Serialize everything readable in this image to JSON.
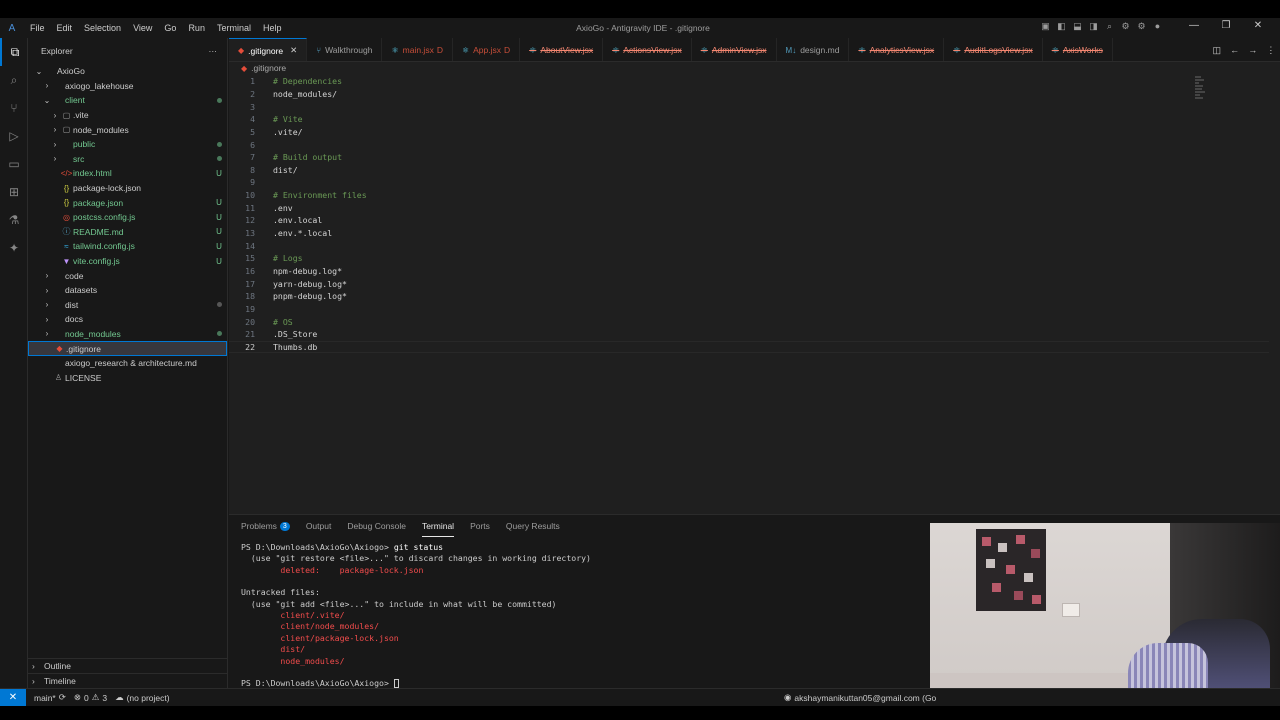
{
  "window": {
    "title": "AxioGo - Antigravity IDE - .gitignore",
    "menu": [
      "File",
      "Edit",
      "Selection",
      "View",
      "Go",
      "Run",
      "Terminal",
      "Help"
    ],
    "controls": [
      "—",
      "❐",
      "✕"
    ]
  },
  "activity_bar": [
    "explorer-icon",
    "search-icon",
    "source-control-icon",
    "run-debug-icon",
    "remote-icon",
    "extensions-icon",
    "testing-icon",
    "agent-icon"
  ],
  "sidebar": {
    "title": "Explorer",
    "more": "···",
    "tree": [
      {
        "label": "AxioGo",
        "depth": 0,
        "chevron": "⌄",
        "icon": "",
        "status": "",
        "color": "plain"
      },
      {
        "label": "axiogo_lakehouse",
        "depth": 1,
        "chevron": "›",
        "icon": "",
        "status": "",
        "color": "plain"
      },
      {
        "label": "client",
        "depth": 1,
        "chevron": "⌄",
        "icon": "",
        "status": "dot",
        "color": "add"
      },
      {
        "label": ".vite",
        "depth": 2,
        "chevron": "›",
        "icon": "▢",
        "status": "",
        "color": "plain"
      },
      {
        "label": "node_modules",
        "depth": 2,
        "chevron": "›",
        "icon": "▢",
        "status": "",
        "color": "plain"
      },
      {
        "label": "public",
        "depth": 2,
        "chevron": "›",
        "icon": "",
        "status": "dot",
        "color": "add"
      },
      {
        "label": "src",
        "depth": 2,
        "chevron": "›",
        "icon": "",
        "status": "dot",
        "color": "add"
      },
      {
        "label": "index.html",
        "depth": 2,
        "chevron": "",
        "icon": "</>",
        "status": "U",
        "color": "add"
      },
      {
        "label": "package-lock.json",
        "depth": 2,
        "chevron": "",
        "icon": "{}",
        "status": "",
        "color": "plain"
      },
      {
        "label": "package.json",
        "depth": 2,
        "chevron": "",
        "icon": "{}",
        "status": "U",
        "color": "add"
      },
      {
        "label": "postcss.config.js",
        "depth": 2,
        "chevron": "",
        "icon": "◎",
        "status": "U",
        "color": "add"
      },
      {
        "label": "README.md",
        "depth": 2,
        "chevron": "",
        "icon": "ⓘ",
        "status": "U",
        "color": "add"
      },
      {
        "label": "tailwind.config.js",
        "depth": 2,
        "chevron": "",
        "icon": "≈",
        "status": "U",
        "color": "add"
      },
      {
        "label": "vite.config.js",
        "depth": 2,
        "chevron": "",
        "icon": "▼",
        "status": "U",
        "color": "add"
      },
      {
        "label": "code",
        "depth": 1,
        "chevron": "›",
        "icon": "",
        "status": "",
        "color": "plain"
      },
      {
        "label": "datasets",
        "depth": 1,
        "chevron": "›",
        "icon": "",
        "status": "",
        "color": "plain"
      },
      {
        "label": "dist",
        "depth": 1,
        "chevron": "›",
        "icon": "",
        "status": "graydot",
        "color": "plain"
      },
      {
        "label": "docs",
        "depth": 1,
        "chevron": "›",
        "icon": "",
        "status": "",
        "color": "plain"
      },
      {
        "label": "node_modules",
        "depth": 1,
        "chevron": "›",
        "icon": "",
        "status": "dot",
        "color": "add"
      },
      {
        "label": ".gitignore",
        "depth": 1,
        "chevron": "",
        "icon": "◆",
        "status": "",
        "color": "plain",
        "selected": true
      },
      {
        "label": "axiogo_research & architecture.md",
        "depth": 1,
        "chevron": "",
        "icon": "",
        "status": "",
        "color": "plain"
      },
      {
        "label": "LICENSE",
        "depth": 1,
        "chevron": "",
        "icon": "♙",
        "status": "",
        "color": "plain"
      }
    ],
    "outline": "Outline",
    "timeline": "Timeline"
  },
  "tabs": [
    {
      "label": ".gitignore",
      "icon": "◆",
      "kind": "active",
      "suffix": "",
      "close": "✕"
    },
    {
      "label": "Walkthrough",
      "icon": "⑂",
      "kind": "plain",
      "suffix": ""
    },
    {
      "label": "main.jsx",
      "icon": "⚛",
      "kind": "del",
      "suffix": "D"
    },
    {
      "label": "App.jsx",
      "icon": "⚛",
      "kind": "del",
      "suffix": "D"
    },
    {
      "label": "AboutView.jsx",
      "icon": "⚛",
      "kind": "err",
      "suffix": ""
    },
    {
      "label": "ActionsView.jsx",
      "icon": "⚛",
      "kind": "err",
      "suffix": ""
    },
    {
      "label": "AdminView.jsx",
      "icon": "⚛",
      "kind": "err",
      "suffix": ""
    },
    {
      "label": "design.md",
      "icon": "M↓",
      "kind": "plain",
      "suffix": ""
    },
    {
      "label": "AnalyticsView.jsx",
      "icon": "⚛",
      "kind": "err",
      "suffix": ""
    },
    {
      "label": "AuditLogsView.jsx",
      "icon": "⚛",
      "kind": "err",
      "suffix": ""
    },
    {
      "label": "AxisWorks",
      "icon": "⚛",
      "kind": "err",
      "suffix": ""
    }
  ],
  "breadcrumb": ".gitignore",
  "editor": {
    "current_line": 22,
    "lines": [
      {
        "n": "1",
        "text": "# Dependencies",
        "comment": true
      },
      {
        "n": "2",
        "text": "node_modules/",
        "comment": false
      },
      {
        "n": "3",
        "text": "",
        "comment": false
      },
      {
        "n": "4",
        "text": "# Vite",
        "comment": true
      },
      {
        "n": "5",
        "text": ".vite/",
        "comment": false
      },
      {
        "n": "6",
        "text": "",
        "comment": false
      },
      {
        "n": "7",
        "text": "# Build output",
        "comment": true
      },
      {
        "n": "8",
        "text": "dist/",
        "comment": false
      },
      {
        "n": "9",
        "text": "",
        "comment": false
      },
      {
        "n": "10",
        "text": "# Environment files",
        "comment": true
      },
      {
        "n": "11",
        "text": ".env",
        "comment": false
      },
      {
        "n": "12",
        "text": ".env.local",
        "comment": false
      },
      {
        "n": "13",
        "text": ".env.*.local",
        "comment": false
      },
      {
        "n": "14",
        "text": "",
        "comment": false
      },
      {
        "n": "15",
        "text": "# Logs",
        "comment": true
      },
      {
        "n": "16",
        "text": "npm-debug.log*",
        "comment": false
      },
      {
        "n": "17",
        "text": "yarn-debug.log*",
        "comment": false
      },
      {
        "n": "18",
        "text": "pnpm-debug.log*",
        "comment": false
      },
      {
        "n": "19",
        "text": "",
        "comment": false
      },
      {
        "n": "20",
        "text": "# OS",
        "comment": true
      },
      {
        "n": "21",
        "text": ".DS_Store",
        "comment": false
      },
      {
        "n": "22",
        "text": "Thumbs.db",
        "comment": false
      }
    ]
  },
  "panel": {
    "tabs": [
      {
        "label": "Problems",
        "count": "3"
      },
      {
        "label": "Output"
      },
      {
        "label": "Debug Console"
      },
      {
        "label": "Terminal",
        "active": true
      },
      {
        "label": "Ports"
      },
      {
        "label": "Query Results"
      }
    ],
    "terminal": [
      {
        "prompt": "PS D:\\Downloads\\AxioGo\\Axiogo> ",
        "cmd": "git status",
        "red": false
      },
      {
        "text": "  (use \"git restore <file>...\" to discard changes in working directory)",
        "red": false
      },
      {
        "text": "        deleted:    package-lock.json",
        "red": true
      },
      {
        "text": "",
        "red": false
      },
      {
        "text": "Untracked files:",
        "red": false
      },
      {
        "text": "  (use \"git add <file>...\" to include in what will be committed)",
        "red": false
      },
      {
        "text": "        client/.vite/",
        "red": true
      },
      {
        "text": "        client/node_modules/",
        "red": true
      },
      {
        "text": "        client/package-lock.json",
        "red": true
      },
      {
        "text": "        dist/",
        "red": true
      },
      {
        "text": "        node_modules/",
        "red": true
      },
      {
        "text": "",
        "red": false
      },
      {
        "prompt": "PS D:\\Downloads\\AxioGo\\Axiogo> ",
        "cmd": "",
        "red": false,
        "cursor": true
      }
    ]
  },
  "statusbar": {
    "remote": "✕",
    "branch": "main*",
    "sync": "⟳",
    "errors": "0",
    "warnings": "3",
    "project": "(no project)",
    "account": "akshaymanikuttan05@gmail.com (Go"
  },
  "colors": {
    "accent": "#0078d4",
    "added": "#73c991",
    "error": "#f14c4c",
    "comment": "#6a9955"
  }
}
